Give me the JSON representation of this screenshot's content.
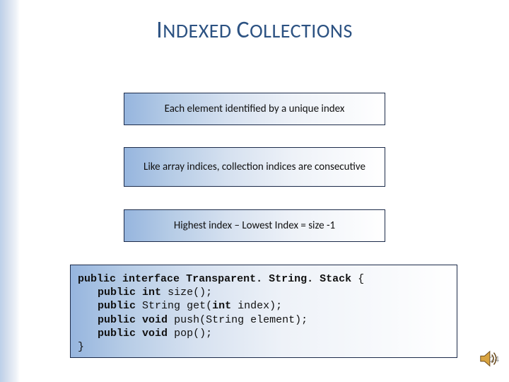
{
  "title": {
    "cap1": "I",
    "w1": "NDEXED",
    "sp": " ",
    "cap2": "C",
    "w2": "OLLECTIONS"
  },
  "boxes": {
    "b1": "Each element identified by  a unique index",
    "b2": "Like array indices, collection indices are consecutive",
    "b3": "Highest index – Lowest Index = size -1"
  },
  "code": {
    "kw_public": "public",
    "kw_interface": "interface",
    "kw_int": "int",
    "kw_void": "void",
    "ty_string": "String",
    "cls": "Transparent. String. Stack",
    "brace_open": "{",
    "brace_close": "}",
    "m1": "size();",
    "m2_name": "get(",
    "m2_argrest": " index);",
    "m3_name": "push(",
    "m3_argrest": " element);",
    "m4": "pop();"
  },
  "footer": {
    "page": "24"
  }
}
